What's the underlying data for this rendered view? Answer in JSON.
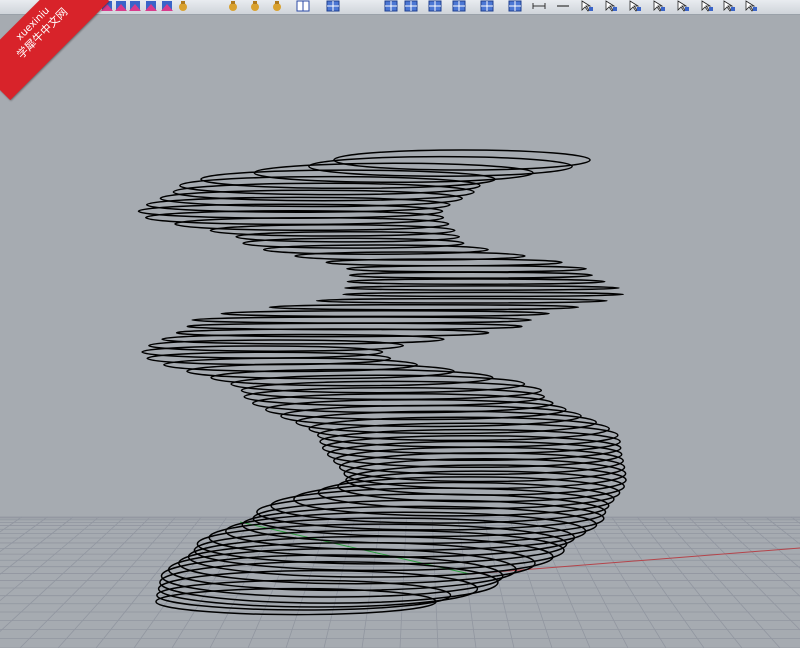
{
  "watermark": {
    "line1": "xuexiniu",
    "line2": "学犀牛中文网",
    "color": "#d8232a"
  },
  "toolbar": {
    "buttons": [
      {
        "icon": "transform-arrow-icon"
      },
      {
        "icon": "transform-arrow-icon"
      },
      {
        "icon": "transform-arrow-icon"
      },
      {
        "icon": "transform-arrow-icon"
      },
      {
        "icon": "transform-arrow-icon"
      },
      {
        "icon": "transform-arrow-icon"
      },
      {
        "icon": "render-teapot-icon"
      },
      {
        "icon": "render-teapot-icon"
      },
      {
        "icon": "render-teapot-icon"
      },
      {
        "icon": "render-teapot-icon"
      },
      {
        "icon": "split-view-icon"
      },
      {
        "icon": "viewport-layout-icon"
      },
      {
        "icon": "viewport-layout-icon"
      },
      {
        "icon": "viewport-layout-icon"
      },
      {
        "icon": "viewport-layout-icon"
      },
      {
        "icon": "viewport-layout-icon"
      },
      {
        "icon": "viewport-layout-icon"
      },
      {
        "icon": "viewport-layout-icon"
      },
      {
        "icon": "distance-icon"
      },
      {
        "icon": "line-icon"
      },
      {
        "icon": "select-cursor-icon"
      },
      {
        "icon": "select-cursor-icon"
      },
      {
        "icon": "select-cursor-icon"
      },
      {
        "icon": "select-cursor-icon"
      },
      {
        "icon": "select-cursor-icon"
      },
      {
        "icon": "select-cursor-icon"
      },
      {
        "icon": "select-cursor-icon"
      },
      {
        "icon": "select-cursor-icon"
      }
    ]
  },
  "viewport": {
    "background_color": "#a6abb1",
    "grid_color": "#9196a0",
    "x_axis_color": "#b5444a",
    "y_axis_color": "#2a9e3c",
    "curve_color": "#000000"
  }
}
